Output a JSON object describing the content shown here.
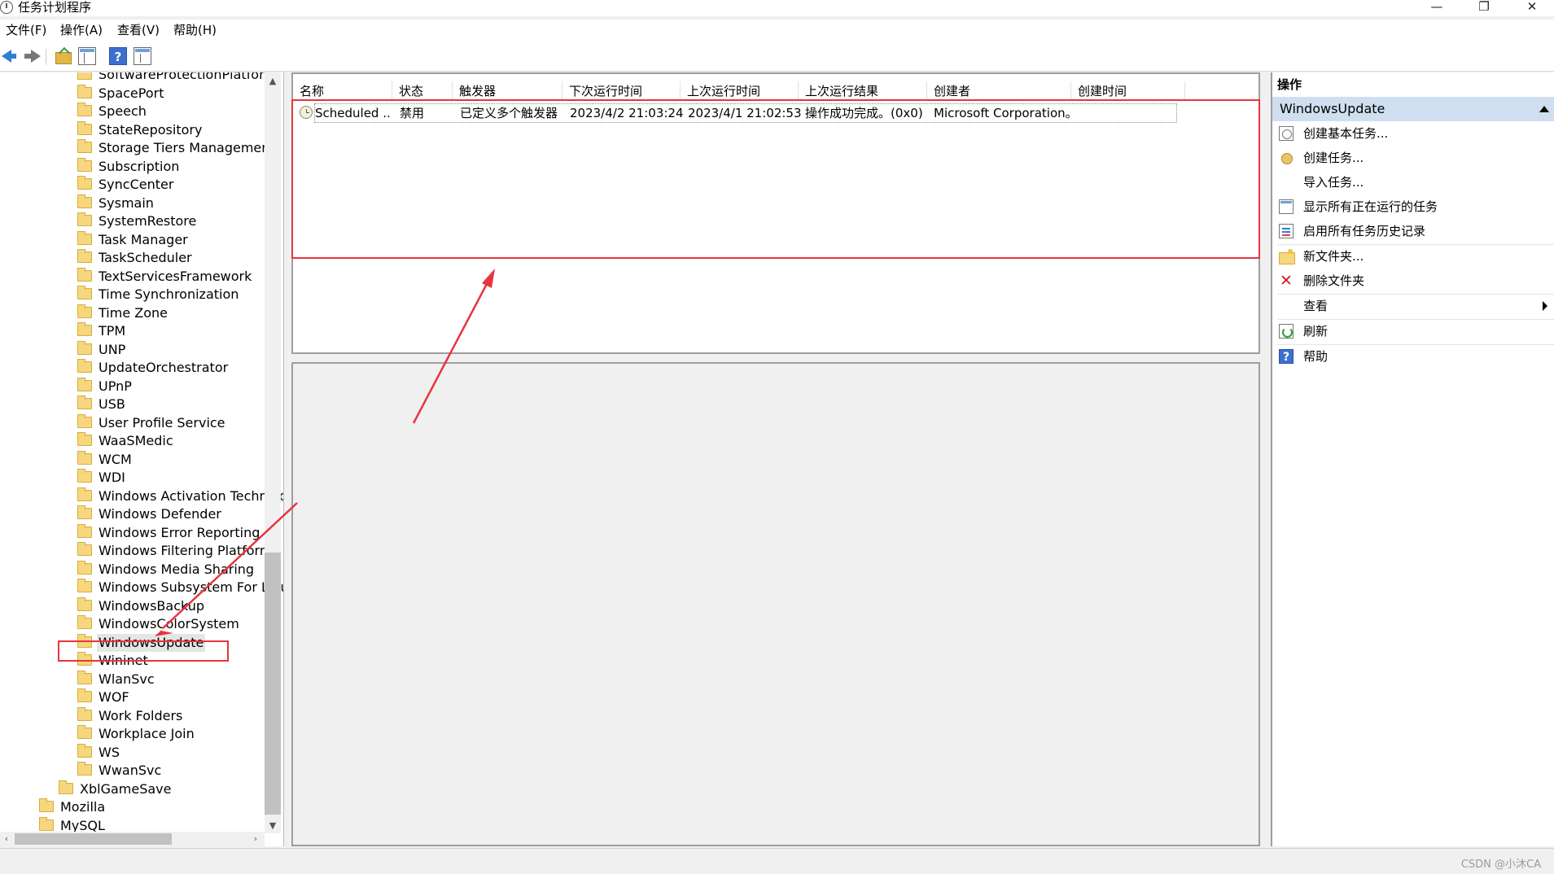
{
  "window": {
    "title": "任务计划程序",
    "controls": {
      "minimize": "—",
      "maximize": "❐",
      "close": "✕"
    }
  },
  "menu": [
    "文件(F)",
    "操作(A)",
    "查看(V)",
    "帮助(H)"
  ],
  "toolbar": {
    "help_label": "?"
  },
  "tree": {
    "items": [
      "SoftwareProtectionPlatform",
      "SpacePort",
      "Speech",
      "StateRepository",
      "Storage Tiers Management",
      "Subscription",
      "SyncCenter",
      "Sysmain",
      "SystemRestore",
      "Task Manager",
      "TaskScheduler",
      "TextServicesFramework",
      "Time Synchronization",
      "Time Zone",
      "TPM",
      "UNP",
      "UpdateOrchestrator",
      "UPnP",
      "USB",
      "User Profile Service",
      "WaaSMedic",
      "WCM",
      "WDI",
      "Windows Activation Technolo",
      "Windows Defender",
      "Windows Error Reporting",
      "Windows Filtering Platform",
      "Windows Media Sharing",
      "Windows Subsystem For Linux",
      "WindowsBackup",
      "WindowsColorSystem",
      "WindowsUpdate",
      "Wininet",
      "WlanSvc",
      "WOF",
      "Work Folders",
      "Workplace Join",
      "WS",
      "WwanSvc"
    ],
    "selected": "WindowsUpdate",
    "parent_items": [
      "XblGameSave"
    ],
    "root_items": [
      "Mozilla",
      "MySQL"
    ],
    "scroll_up": "▲",
    "scroll_down": "▼",
    "scroll_left": "‹",
    "scroll_right": "›"
  },
  "task_table": {
    "headers": [
      "名称",
      "状态",
      "触发器",
      "下次运行时间",
      "上次运行时间",
      "上次运行结果",
      "创建者",
      "创建时间"
    ],
    "rows": [
      [
        "Scheduled ...",
        "禁用",
        "已定义多个触发器",
        "2023/4/2 21:03:24",
        "2023/4/1 21:02:53",
        "操作成功完成。(0x0)",
        "Microsoft Corporation。",
        ""
      ]
    ]
  },
  "actions": {
    "header": "操作",
    "section": "WindowsUpdate",
    "items": [
      {
        "label": "创建基本任务...",
        "icon": "basic-task-icon"
      },
      {
        "label": "创建任务...",
        "icon": "task-icon"
      },
      {
        "label": "导入任务...",
        "icon": ""
      },
      {
        "label": "显示所有正在运行的任务",
        "icon": "running-tasks-icon"
      },
      {
        "label": "启用所有任务历史记录",
        "icon": "history-icon"
      },
      {
        "label": "新文件夹...",
        "icon": "new-folder-icon"
      },
      {
        "label": "删除文件夹",
        "icon": "delete-icon"
      },
      {
        "label": "查看",
        "icon": ""
      },
      {
        "label": "刷新",
        "icon": "refresh-icon"
      },
      {
        "label": "帮助",
        "icon": "help-icon"
      }
    ]
  },
  "status": {
    "watermark": "CSDN @小沐CA"
  },
  "colors": {
    "annotation": "#e8343f",
    "selection_section": "#cfdff0"
  }
}
